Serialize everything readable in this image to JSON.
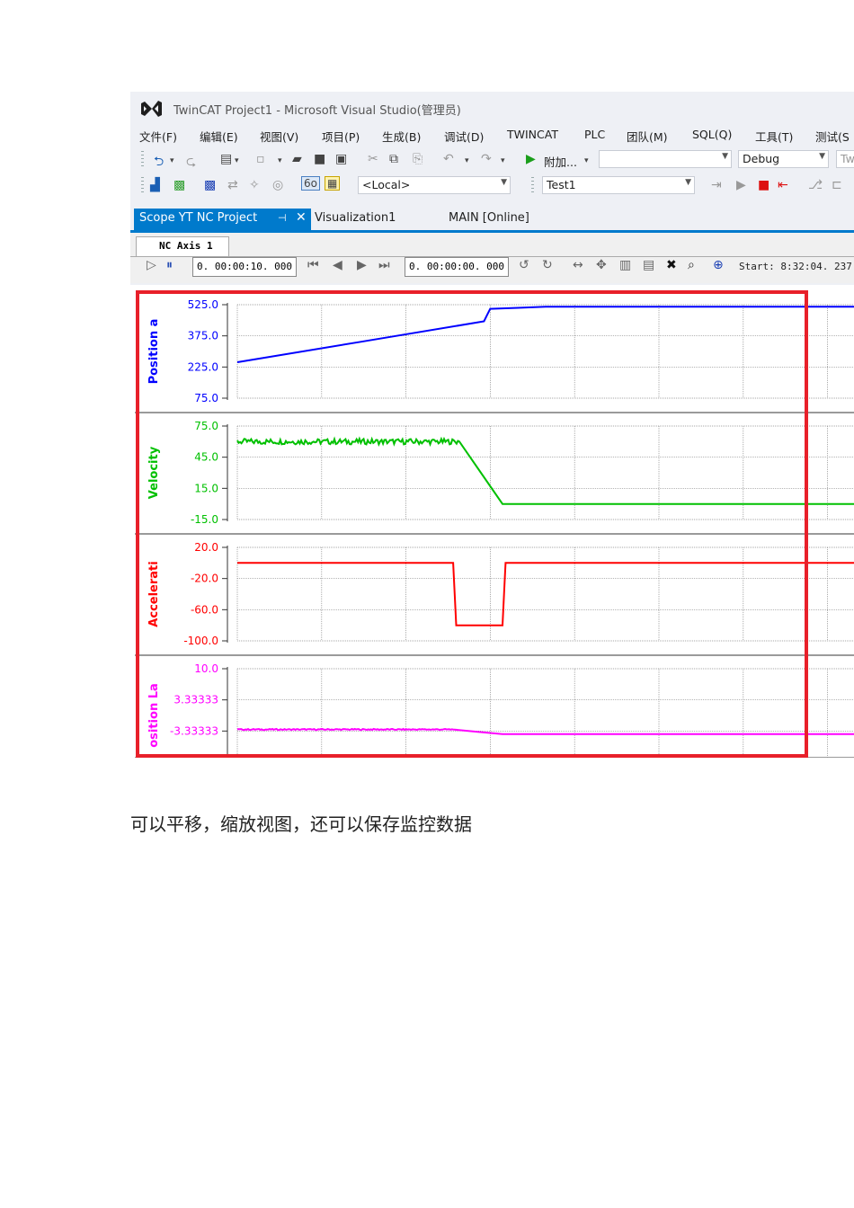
{
  "window": {
    "title": "TwinCAT Project1 - Microsoft Visual Studio(管理员)"
  },
  "menu": [
    "文件(F)",
    "编辑(E)",
    "视图(V)",
    "项目(P)",
    "生成(B)",
    "调试(D)",
    "TWINCAT",
    "PLC",
    "团队(M)",
    "SQL(Q)",
    "工具(T)",
    "测试(S"
  ],
  "toolbar": {
    "attach_label": "附加...",
    "config_value": "Debug",
    "local_value": "<Local>",
    "target_value": "Test1",
    "cutoff_value": "Tw"
  },
  "tabs": {
    "active": "Scope YT NC Project",
    "pin_icon": "pin-icon",
    "close_glyph": "✕",
    "second": "Visualization1",
    "third": "MAIN [Online]"
  },
  "scope": {
    "axis_tab": "NC Axis 1",
    "time_span": "0. 00:00:10. 000",
    "time_offset": "0. 00:00:00. 000",
    "start": "Start: 8:32:04. 237"
  },
  "colors": {
    "accent": "#007acc",
    "highlight_box": "#e8202a",
    "position": "#0000ff",
    "velocity": "#00c000",
    "acceleration": "#ff0000",
    "position_lag": "#ff00ff"
  },
  "chart_data": [
    {
      "type": "line",
      "ylabel": "Position a",
      "yticks": [
        "525.0",
        "375.0",
        "225.0",
        "75.0"
      ],
      "ylim": [
        75,
        525
      ],
      "xlim": [
        0,
        10
      ],
      "grid": true,
      "series": [
        {
          "color": "#0000ff",
          "x": [
            0,
            4.0,
            4.1,
            5.0,
            10
          ],
          "y": [
            248,
            445,
            505,
            515,
            515
          ]
        }
      ]
    },
    {
      "type": "line",
      "ylabel": "Velocity",
      "yticks": [
        "75.0",
        "45.0",
        "15.0",
        "-15.0"
      ],
      "ylim": [
        -15,
        75
      ],
      "xlim": [
        0,
        10
      ],
      "grid": true,
      "series": [
        {
          "color": "#00c000",
          "x": [
            0,
            3.6,
            4.3,
            10
          ],
          "y": [
            60,
            60,
            0,
            0
          ],
          "noisy_until": 3.6
        }
      ]
    },
    {
      "type": "line",
      "ylabel": "Accelerati",
      "yticks": [
        "20.0",
        "-20.0",
        "-60.0",
        "-100.0"
      ],
      "ylim": [
        -100,
        20
      ],
      "xlim": [
        0,
        10
      ],
      "grid": true,
      "series": [
        {
          "color": "#ff0000",
          "x": [
            0,
            3.5,
            3.55,
            4.3,
            4.35,
            10
          ],
          "y": [
            0,
            0,
            -80,
            -80,
            0,
            0
          ]
        }
      ]
    },
    {
      "type": "line",
      "ylabel": "osition La",
      "yticks": [
        "10.0",
        "3.33333",
        "-3.33333"
      ],
      "ylim": [
        -10,
        10
      ],
      "xlim": [
        0,
        10
      ],
      "grid": true,
      "series": [
        {
          "color": "#ff00ff",
          "x": [
            0,
            3.5,
            4.3,
            10
          ],
          "y": [
            -3.0,
            -3.0,
            -4.0,
            -4.0
          ],
          "noisy_until": 3.5
        }
      ]
    }
  ],
  "caption": "可以平移，缩放视图，还可以保存监控数据"
}
